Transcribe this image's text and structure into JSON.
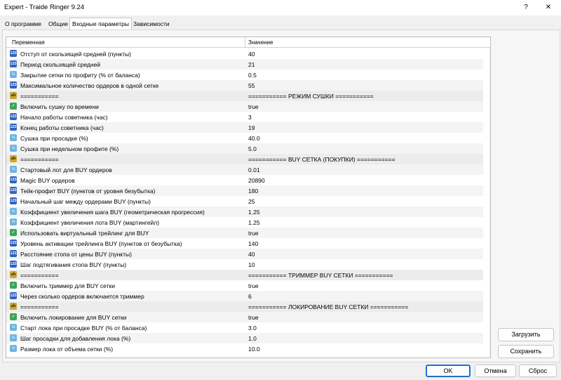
{
  "window": {
    "title": "Expert - Traide Ringer 9.24",
    "help_glyph": "?",
    "close_glyph": "✕"
  },
  "tabs": [
    {
      "label": "О программе",
      "active": false
    },
    {
      "label": "Общие",
      "active": false
    },
    {
      "label": "Входные параметры",
      "active": true
    },
    {
      "label": "Зависимости",
      "active": false
    }
  ],
  "grid": {
    "header": {
      "name": "Переменная",
      "value": "Значение"
    },
    "rows": [
      {
        "type": "int",
        "name": "Отступ от скользящей средней (пункты)",
        "value": "40"
      },
      {
        "type": "int",
        "name": "Период скользящей средней",
        "value": "21"
      },
      {
        "type": "double",
        "name": "Закрытие сетки по профиту (% от баланса)",
        "value": "0.5"
      },
      {
        "type": "int",
        "name": "Максимальное количество ордеров в одной сетке",
        "value": "55"
      },
      {
        "type": "string",
        "name": "===========",
        "value": "=========== РЕЖИМ СУШКИ ==========="
      },
      {
        "type": "bool",
        "name": "Включить сушку по времени",
        "value": "true"
      },
      {
        "type": "int",
        "name": "Начало работы советника (час)",
        "value": "3"
      },
      {
        "type": "int",
        "name": "Конец работы советника (час)",
        "value": "19"
      },
      {
        "type": "double",
        "name": "Сушка при просадке (%)",
        "value": "40.0"
      },
      {
        "type": "double",
        "name": "Сушка при недельном профите (%)",
        "value": "5.0"
      },
      {
        "type": "string",
        "name": "===========",
        "value": "=========== BUY СЕТКА (ПОКУПКИ) ==========="
      },
      {
        "type": "double",
        "name": "Стартовый лот для BUY ордеров",
        "value": "0.01"
      },
      {
        "type": "int",
        "name": "Magic BUY ордеров",
        "value": "20890"
      },
      {
        "type": "int",
        "name": "Тейк-профит BUY (пунктов от уровня безубытка)",
        "value": "180"
      },
      {
        "type": "int",
        "name": "Начальный шаг между ордерами BUY (пункты)",
        "value": "25"
      },
      {
        "type": "double",
        "name": "Коэффициент увеличения шага BUY (геометрическая прогрессия)",
        "value": "1.25"
      },
      {
        "type": "double",
        "name": "Коэффициент увеличения лота BUY (мартингейл)",
        "value": "1.25"
      },
      {
        "type": "bool",
        "name": "Использовать виртуальный трейлинг для BUY",
        "value": "true"
      },
      {
        "type": "int",
        "name": "Уровень активации трейлинга BUY (пунктов от безубытка)",
        "value": "140"
      },
      {
        "type": "int",
        "name": "Расстояние стопа от цены BUY (пункты)",
        "value": "40"
      },
      {
        "type": "int",
        "name": "Шаг подтягивания стопа BUY (пункты)",
        "value": "10"
      },
      {
        "type": "string",
        "name": "===========",
        "value": "=========== ТРИММЕР BUY СЕТКИ ==========="
      },
      {
        "type": "bool",
        "name": "Включить триммер для BUY сетки",
        "value": "true"
      },
      {
        "type": "int",
        "name": "Через сколько ордеров включается триммер",
        "value": "6"
      },
      {
        "type": "string",
        "name": "===========",
        "value": "=========== ЛОКИРОВАНИЕ BUY СЕТКИ ==========="
      },
      {
        "type": "bool",
        "name": "Включить локирование для BUY сетки",
        "value": "true"
      },
      {
        "type": "double",
        "name": "Старт лока при просадке BUY (% от баланса)",
        "value": "3.0"
      },
      {
        "type": "double",
        "name": "Шаг просадки для добавления лока (%)",
        "value": "1.0"
      },
      {
        "type": "double",
        "name": "Размер лока от объема сетки (%)",
        "value": "10.0"
      }
    ]
  },
  "icons": {
    "int": "123",
    "double": "½",
    "string": "ab",
    "bool": "✓"
  },
  "side_buttons": {
    "load": "Загрузить",
    "save": "Сохранить"
  },
  "footer_buttons": {
    "ok": "OK",
    "cancel": "Отмена",
    "reset": "Сброс"
  },
  "scroll": {
    "up": "▲",
    "down": "▼"
  }
}
